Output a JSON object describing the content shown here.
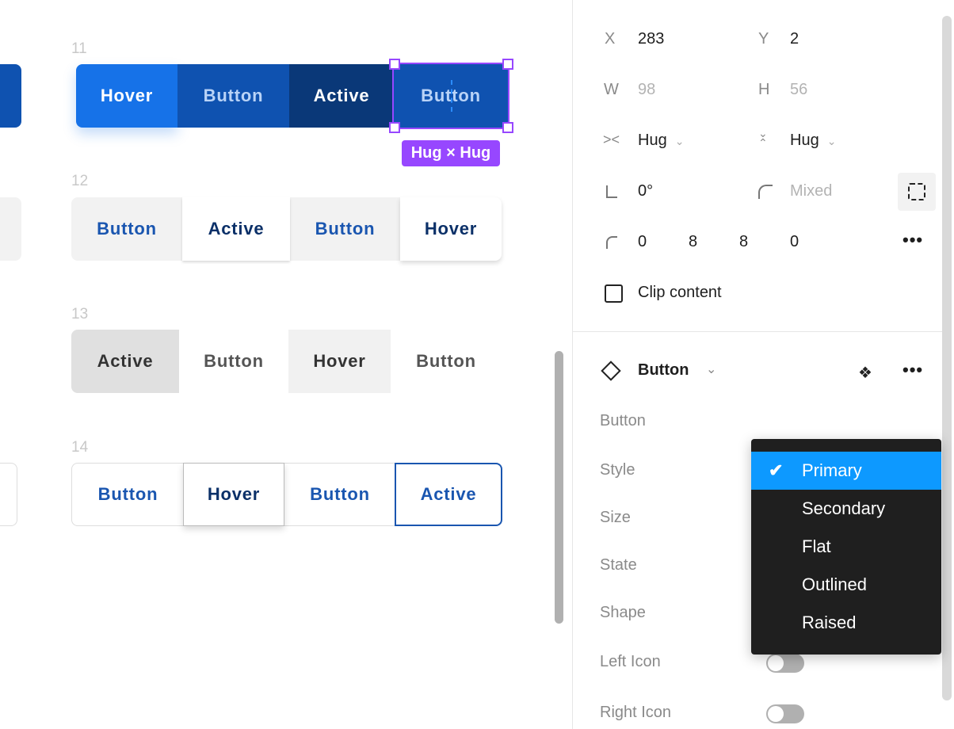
{
  "canvas": {
    "rows": [
      {
        "label": "11",
        "buttons": [
          "Hover",
          "Button",
          "Active",
          "Button"
        ]
      },
      {
        "label": "12",
        "buttons": [
          "Button",
          "Active",
          "Button",
          "Hover"
        ]
      },
      {
        "label": "13",
        "buttons": [
          "Active",
          "Button",
          "Hover",
          "Button"
        ]
      },
      {
        "label": "14",
        "buttons": [
          "Button",
          "Hover",
          "Button",
          "Active"
        ]
      }
    ],
    "selection_badge": "Hug × Hug",
    "colors": {
      "selection": "#9747ff",
      "primary": "#0f52b0",
      "hover": "#1672e8",
      "active": "#0a3878"
    }
  },
  "panel": {
    "x": {
      "label": "X",
      "value": "283"
    },
    "y": {
      "label": "Y",
      "value": "2"
    },
    "w": {
      "label": "W",
      "value": "98"
    },
    "h": {
      "label": "H",
      "value": "56"
    },
    "width_mode": "Hug",
    "height_mode": "Hug",
    "rotation": "0°",
    "radius": "Mixed",
    "corners": [
      "0",
      "8",
      "8",
      "0"
    ],
    "clip_content": {
      "label": "Clip content",
      "checked": false
    },
    "component": {
      "name": "Button",
      "props": [
        "Button",
        "Style",
        "Size",
        "State",
        "Shape",
        "Left Icon",
        "Right Icon"
      ],
      "left_icon": false,
      "right_icon": false
    },
    "style_dropdown": {
      "options": [
        "Primary",
        "Secondary",
        "Flat",
        "Outlined",
        "Raised"
      ],
      "selected": "Primary",
      "highlight": "#0d99ff"
    }
  }
}
